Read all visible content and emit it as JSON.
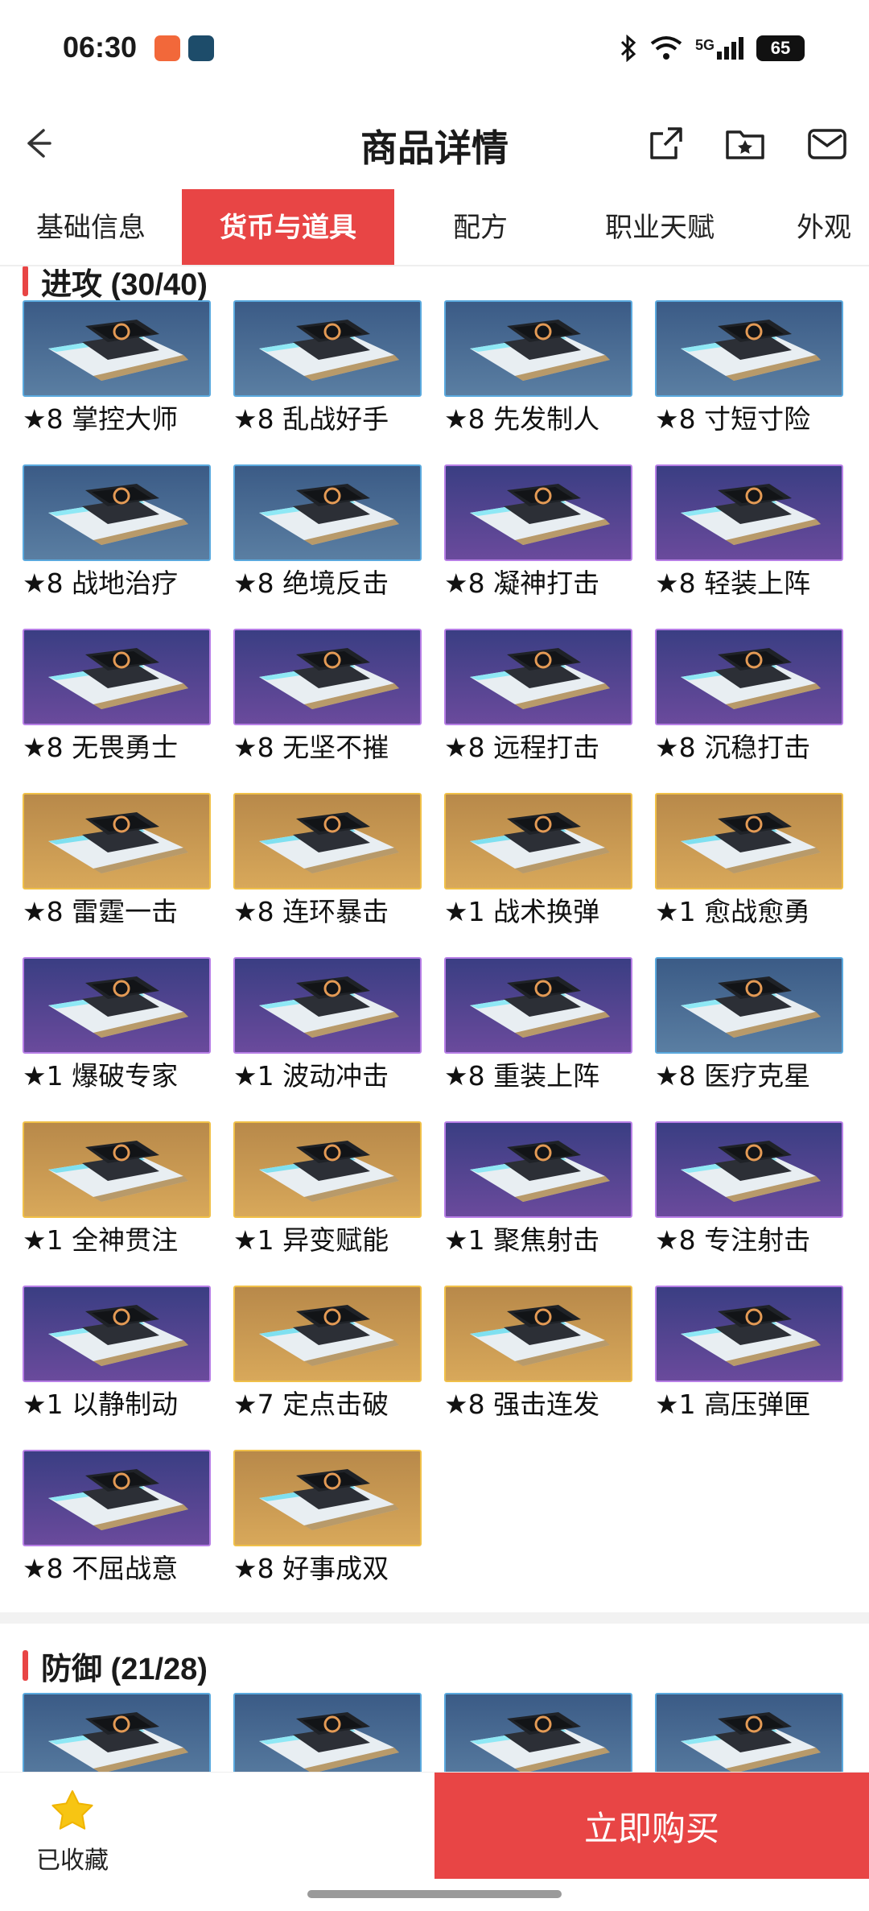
{
  "status_bar": {
    "time": "06:30",
    "network": "5G",
    "battery": "65"
  },
  "header": {
    "title": "商品详情"
  },
  "tabs": [
    {
      "label": "基础信息",
      "active": false
    },
    {
      "label": "货币与道具",
      "active": true
    },
    {
      "label": "配方",
      "active": false
    },
    {
      "label": "职业天赋",
      "active": false
    },
    {
      "label": "外观",
      "active": false
    }
  ],
  "sections": [
    {
      "title": "进攻 (30/40)",
      "items": [
        {
          "label": "★8 掌控大师",
          "tier": "blue"
        },
        {
          "label": "★8 乱战好手",
          "tier": "blue"
        },
        {
          "label": "★8 先发制人",
          "tier": "blue"
        },
        {
          "label": "★8 寸短寸险",
          "tier": "blue"
        },
        {
          "label": "★8 战地治疗",
          "tier": "blue"
        },
        {
          "label": "★8 绝境反击",
          "tier": "blue"
        },
        {
          "label": "★8 凝神打击",
          "tier": "purple"
        },
        {
          "label": "★8 轻装上阵",
          "tier": "purple"
        },
        {
          "label": "★8 无畏勇士",
          "tier": "purple"
        },
        {
          "label": "★8 无坚不摧",
          "tier": "purple"
        },
        {
          "label": "★8 远程打击",
          "tier": "purple"
        },
        {
          "label": "★8 沉稳打击",
          "tier": "purple"
        },
        {
          "label": "★8 雷霆一击",
          "tier": "gold"
        },
        {
          "label": "★8 连环暴击",
          "tier": "gold"
        },
        {
          "label": "★1 战术换弹",
          "tier": "gold"
        },
        {
          "label": "★1 愈战愈勇",
          "tier": "gold"
        },
        {
          "label": "★1 爆破专家",
          "tier": "purple"
        },
        {
          "label": "★1 波动冲击",
          "tier": "purple"
        },
        {
          "label": "★8 重装上阵",
          "tier": "purple"
        },
        {
          "label": "★8 医疗克星",
          "tier": "blue"
        },
        {
          "label": "★1 全神贯注",
          "tier": "gold"
        },
        {
          "label": "★1 异变赋能",
          "tier": "gold"
        },
        {
          "label": "★1 聚焦射击",
          "tier": "purple"
        },
        {
          "label": "★8 专注射击",
          "tier": "purple"
        },
        {
          "label": "★1 以静制动",
          "tier": "purple"
        },
        {
          "label": "★7 定点击破",
          "tier": "gold"
        },
        {
          "label": "★8 强击连发",
          "tier": "gold"
        },
        {
          "label": "★1 高压弹匣",
          "tier": "purple"
        },
        {
          "label": "★8 不屈战意",
          "tier": "purple"
        },
        {
          "label": "★8 好事成双",
          "tier": "gold"
        }
      ]
    },
    {
      "title": "防御 (21/28)",
      "items": [
        {
          "label": "",
          "tier": "blue"
        },
        {
          "label": "",
          "tier": "blue"
        },
        {
          "label": "",
          "tier": "blue"
        },
        {
          "label": "",
          "tier": "blue"
        }
      ]
    }
  ],
  "bottom": {
    "favorite_label": "已收藏",
    "buy_label": "立即购买"
  }
}
